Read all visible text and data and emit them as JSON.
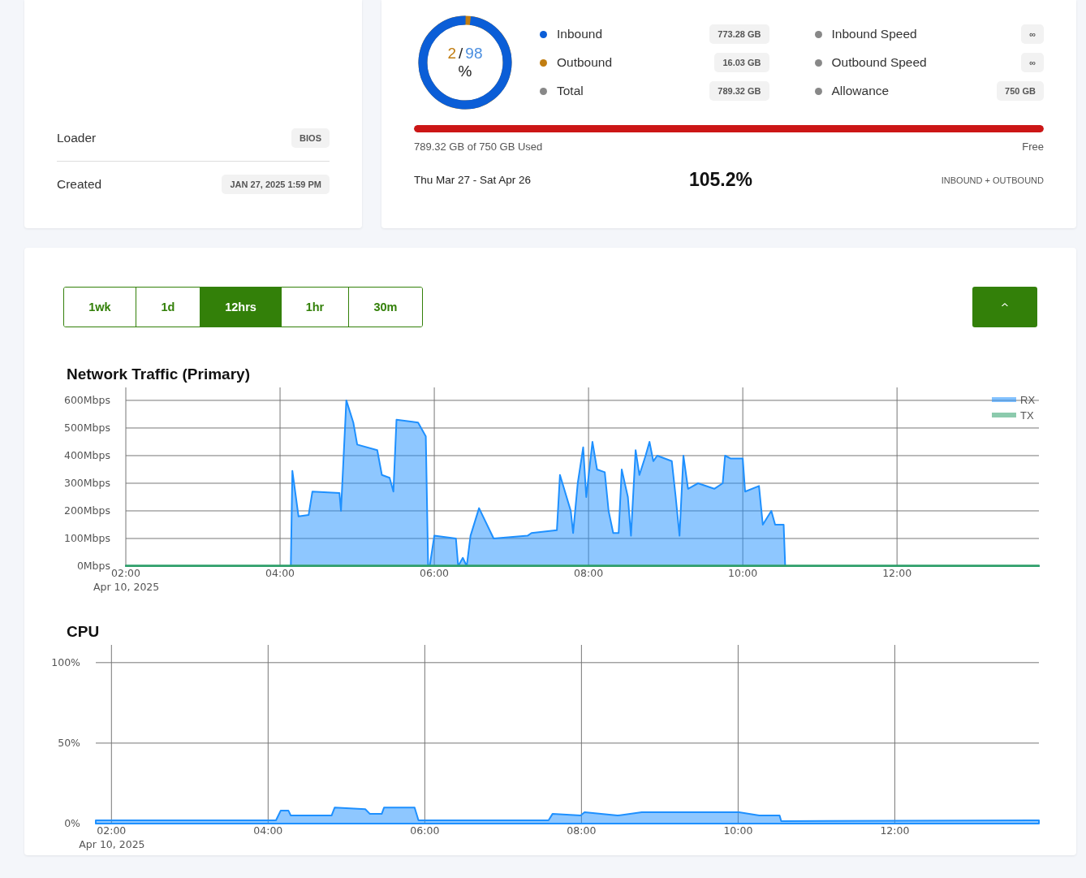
{
  "details": {
    "rows": [
      {
        "label": "Loader",
        "value": "BIOS"
      },
      {
        "label": "Created",
        "value": "JAN 27, 2025 1:59 PM"
      }
    ]
  },
  "transfer": {
    "donut": {
      "outbound_share": "2",
      "separator": "/",
      "inbound_share": "98",
      "unit": "%",
      "level": 0.98
    },
    "stats": [
      {
        "label": "Inbound",
        "value": "773.28 GB",
        "color": "#0b5ed7"
      },
      {
        "label": "Outbound",
        "value": "16.03 GB",
        "color": "#c17d11"
      },
      {
        "label": "Total",
        "value": "789.32 GB",
        "color": "#888888"
      }
    ],
    "limits": [
      {
        "label": "Inbound Speed",
        "value": "∞",
        "color": "#888888"
      },
      {
        "label": "Outbound Speed",
        "value": "∞",
        "color": "#888888"
      },
      {
        "label": "Allowance",
        "value": "750 GB",
        "color": "#888888"
      }
    ],
    "usage_bar": {
      "level": 1,
      "over_limit": true
    },
    "used_text": "789.32 GB of 750 GB Used",
    "free_text": "Free",
    "period": "Thu Mar 27 - Sat Apr 26",
    "percent": "105.2%",
    "basis": "INBOUND + OUTBOUND"
  },
  "range_tabs": [
    {
      "label": "1wk",
      "selected": false
    },
    {
      "label": "1d",
      "selected": false
    },
    {
      "label": "12hrs",
      "selected": true
    },
    {
      "label": "1hr",
      "selected": false
    },
    {
      "label": "30m",
      "selected": false
    }
  ],
  "collapse_button": {
    "icon": "^"
  },
  "network_chart": {
    "date_label": "Apr 10, 2025",
    "chart_data": {
      "type": "area",
      "title": "Network Traffic (Primary)",
      "x": [
        2.0,
        4.14,
        4.16,
        4.24,
        4.37,
        4.42,
        4.77,
        4.79,
        4.86,
        4.95,
        5.0,
        5.26,
        5.32,
        5.42,
        5.47,
        5.51,
        5.79,
        5.89,
        5.92,
        5.94,
        6.0,
        6.28,
        6.31,
        6.37,
        6.42,
        6.47,
        6.58,
        6.77,
        7.21,
        7.26,
        7.59,
        7.63,
        7.77,
        7.8,
        7.86,
        7.93,
        7.97,
        8.05,
        8.11,
        8.21,
        8.26,
        8.32,
        8.39,
        8.43,
        8.51,
        8.55,
        8.61,
        8.66,
        8.74,
        8.79,
        8.84,
        8.89,
        9.08,
        9.13,
        9.18,
        9.23,
        9.29,
        9.42,
        9.63,
        9.74,
        9.77,
        9.84,
        10.0,
        10.03,
        10.21,
        10.26,
        10.37,
        10.42,
        10.53,
        10.55,
        13.84
      ],
      "series": [
        {
          "name": "RX",
          "color": "#1e90ff",
          "values": [
            0,
            0,
            345,
            180,
            185,
            270,
            265,
            200,
            600,
            520,
            440,
            420,
            330,
            320,
            270,
            530,
            520,
            470,
            0,
            0,
            110,
            100,
            0,
            30,
            0,
            110,
            210,
            100,
            110,
            120,
            130,
            330,
            200,
            120,
            300,
            430,
            250,
            450,
            350,
            340,
            200,
            120,
            120,
            350,
            250,
            110,
            420,
            330,
            400,
            450,
            380,
            400,
            380,
            250,
            110,
            400,
            280,
            300,
            280,
            300,
            400,
            390,
            390,
            270,
            290,
            150,
            200,
            150,
            150,
            0,
            0
          ]
        },
        {
          "name": "TX",
          "color": "#2e9e6a",
          "values": [
            2,
            2,
            2,
            2,
            2,
            2,
            2,
            2,
            2,
            2,
            2,
            2,
            2,
            2,
            2,
            2,
            2,
            2,
            2,
            2,
            2,
            2,
            2,
            2,
            2,
            2,
            2,
            2,
            2,
            2,
            2,
            2,
            2,
            2,
            2,
            2,
            2,
            2,
            2,
            2,
            2,
            2,
            2,
            2,
            2,
            2,
            2,
            2,
            2,
            2,
            2,
            2,
            2,
            2,
            2,
            2,
            2,
            2,
            2,
            2,
            2,
            2,
            2,
            2,
            2,
            2,
            2,
            2,
            2,
            2,
            2
          ]
        }
      ],
      "grid": true,
      "legend": "upper right",
      "xlim": [
        2,
        13.84
      ],
      "ylim": [
        0,
        641
      ],
      "xticks": [
        {
          "value": 2,
          "label": "02:00"
        },
        {
          "value": 4,
          "label": "04:00"
        },
        {
          "value": 6,
          "label": "06:00"
        },
        {
          "value": 8,
          "label": "08:00"
        },
        {
          "value": 10,
          "label": "10:00"
        },
        {
          "value": 12,
          "label": "12:00"
        }
      ],
      "yticks": [
        {
          "value": 0,
          "label": "0Mbps"
        },
        {
          "value": 100,
          "label": "100Mbps"
        },
        {
          "value": 200,
          "label": "200Mbps"
        },
        {
          "value": 300,
          "label": "300Mbps"
        },
        {
          "value": 400,
          "label": "400Mbps"
        },
        {
          "value": 500,
          "label": "500Mbps"
        },
        {
          "value": 600,
          "label": "600Mbps"
        }
      ]
    }
  },
  "cpu_chart": {
    "date_label": "Apr 10, 2025",
    "chart_data": {
      "type": "area",
      "title": "CPU",
      "x": [
        1.8,
        4.0,
        4.1,
        4.16,
        4.26,
        4.29,
        4.81,
        4.85,
        5.24,
        5.3,
        5.45,
        5.48,
        5.87,
        5.92,
        7.58,
        7.63,
        7.99,
        8.04,
        8.46,
        8.77,
        10.01,
        10.27,
        10.53,
        10.55,
        13.84
      ],
      "grid": true,
      "series": [
        {
          "color": "#1e90ff",
          "values": [
            2,
            2,
            2,
            8,
            8,
            5,
            5,
            10,
            9,
            6,
            6,
            10,
            10,
            2,
            2,
            6,
            5,
            7,
            5,
            7,
            7,
            5,
            5,
            1.5,
            2
          ]
        }
      ],
      "xlim": [
        1.8,
        13.84
      ],
      "ylim": [
        0,
        110
      ],
      "xticks": [
        {
          "value": 2,
          "label": "02:00"
        },
        {
          "value": 4,
          "label": "04:00"
        },
        {
          "value": 6,
          "label": "06:00"
        },
        {
          "value": 8,
          "label": "08:00"
        },
        {
          "value": 10,
          "label": "10:00"
        },
        {
          "value": 12,
          "label": "12:00"
        }
      ],
      "yticks": [
        {
          "value": 0,
          "label": "0%"
        },
        {
          "value": 50,
          "label": "50%"
        },
        {
          "value": 100,
          "label": "100%"
        }
      ]
    }
  }
}
